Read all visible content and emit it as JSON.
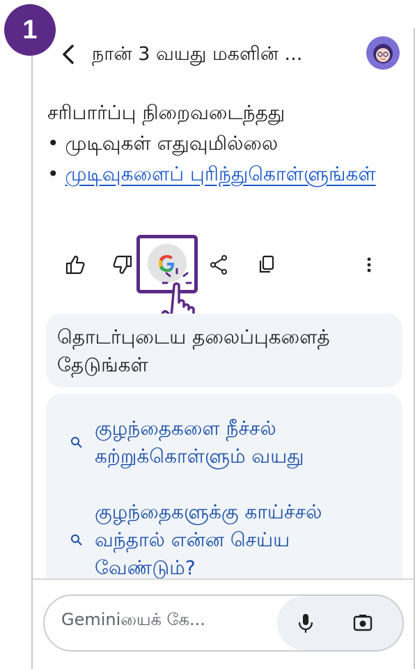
{
  "step_badge": {
    "number": "1",
    "color": "#5b2a86"
  },
  "header": {
    "title": "நான் 3 வயது மகளின் ...",
    "back_icon": "chevron-left-icon",
    "avatar": "user-avatar"
  },
  "answer": {
    "line1": "சரிபார்ப்பு நிறைவடைந்தது",
    "bullet1": "• முடிவுகள் எதுவுமில்லை",
    "bullet2_prefix": "• ",
    "bullet2_link": "முடிவுகளைப் புரிந்துகொள்ளுங்கள்",
    "link_color": "#1a57c8"
  },
  "actions": {
    "icons": [
      "thumbs-up-icon",
      "thumbs-down-icon",
      "google-check-icon",
      "share-icon",
      "copy-icon",
      "more-vert-icon"
    ]
  },
  "related": {
    "title": "தொடர்புடைய தலைப்புகளைத் தேடுங்கள்"
  },
  "suggestions": [
    {
      "text": "குழந்தைகளை நீச்சல் கற்றுக்கொள்ளும் வயது"
    },
    {
      "text": "குழந்தைகளுக்கு காய்ச்சல் வந்தால் என்ன செய்ய வேண்டும்?"
    }
  ],
  "input": {
    "placeholder": "Geminiயைக் கே..."
  },
  "colors": {
    "accent": "#5b2a86",
    "suggestion_text": "#1a4fa8",
    "panel_bg": "#f1f4f9"
  }
}
